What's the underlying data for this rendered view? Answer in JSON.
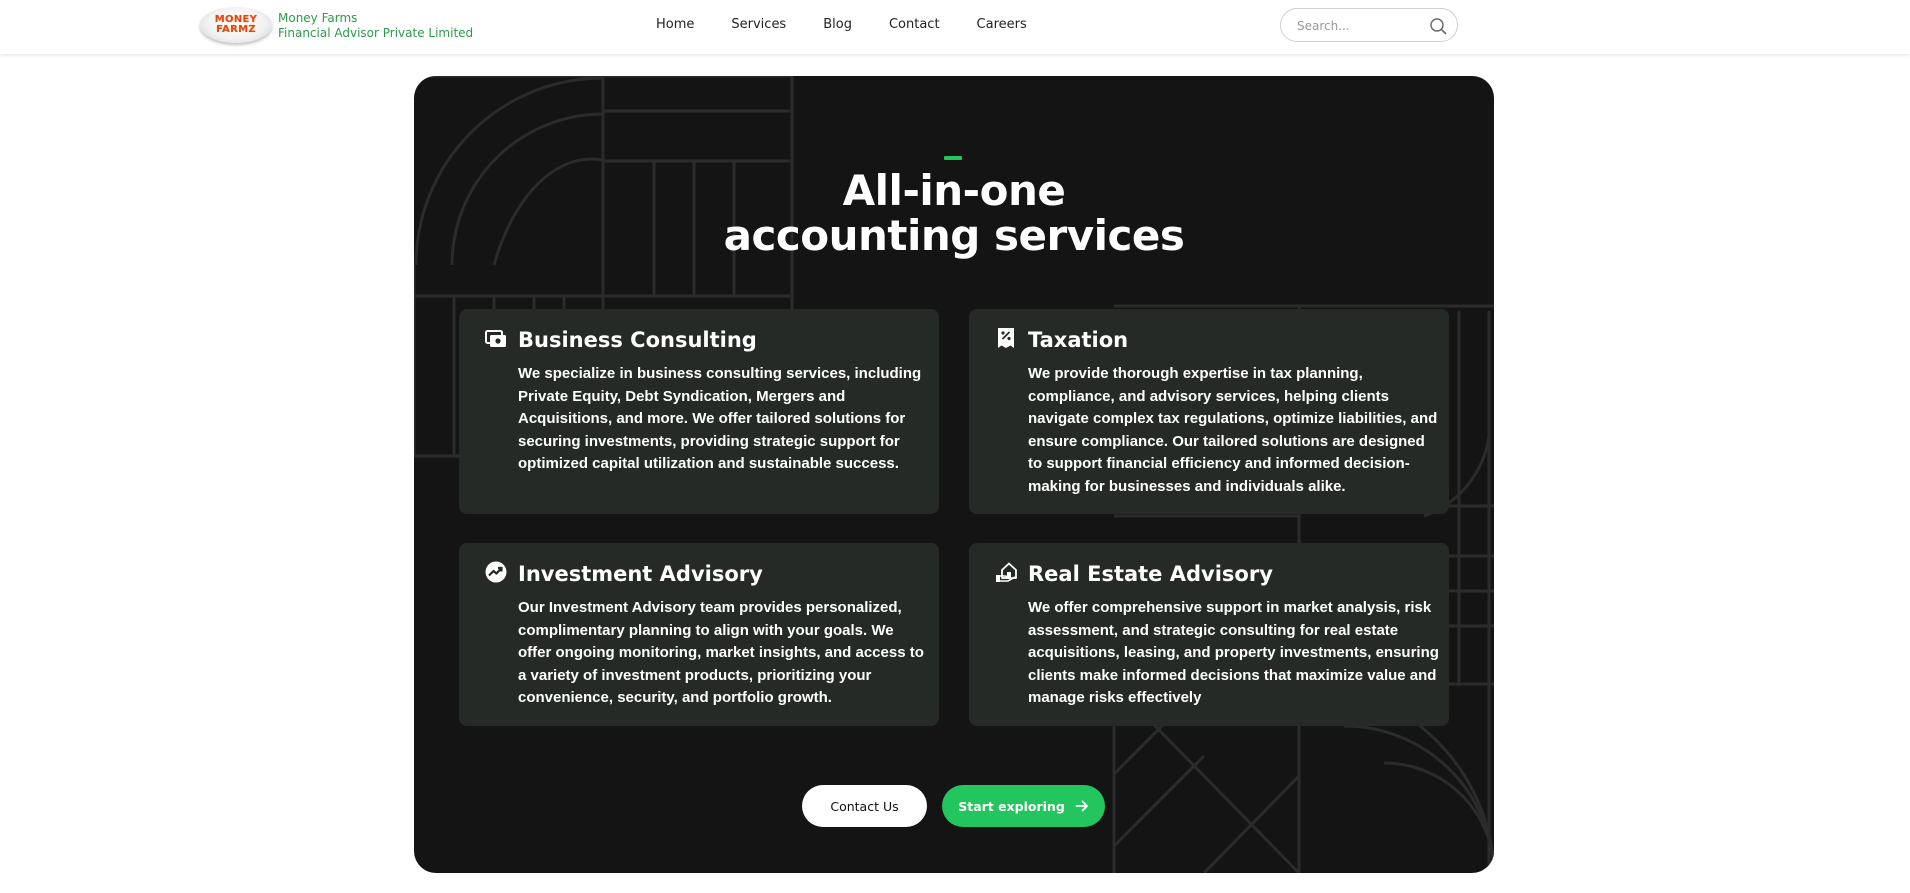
{
  "header": {
    "logo": {
      "line1": "MONEY",
      "line2": "FARMZ"
    },
    "brand": {
      "name": "Money Farms",
      "tagline": "Financial Advisor Private Limited"
    },
    "nav": [
      {
        "label": "Home"
      },
      {
        "label": "Services"
      },
      {
        "label": "Blog"
      },
      {
        "label": "Contact"
      },
      {
        "label": "Careers"
      }
    ],
    "search": {
      "placeholder": "Search...",
      "value": ""
    }
  },
  "services_section": {
    "title_line1": "All-in-one",
    "title_line2": "accounting services",
    "cards": [
      {
        "icon": "briefcase-icon",
        "title": "Business Consulting",
        "description": "We specialize in business consulting services, including Private Equity, Debt Syndication, Mergers and Acquisitions, and more. We offer tailored solutions for securing investments, providing strategic support for optimized capital utilization and sustainable success."
      },
      {
        "icon": "tax-receipt-icon",
        "title": "Taxation",
        "description": "We provide thorough expertise in tax planning, compliance, and advisory services, helping clients navigate complex tax regulations, optimize liabilities, and ensure compliance. Our tailored solutions are designed to support financial efficiency and informed decision-making for businesses and individuals alike."
      },
      {
        "icon": "trending-up-icon",
        "title": "Investment Advisory",
        "description": "Our Investment Advisory team provides personalized, complimentary planning to align with your goals. We offer ongoing monitoring, market insights, and access to a variety of investment products, prioritizing your convenience, security, and portfolio growth."
      },
      {
        "icon": "home-hand-icon",
        "title": "Real Estate Advisory",
        "description": "We offer comprehensive support in market analysis, risk assessment, and strategic consulting for real estate acquisitions, leasing, and property investments, ensuring clients make informed decisions that maximize value and manage risks effectively"
      }
    ],
    "buttons": {
      "contact": "Contact Us",
      "explore": "Start exploring"
    }
  },
  "colors": {
    "brand_green": "#2e9a4a",
    "accent_green": "#22c55e",
    "section_bg": "#141414",
    "card_bg": "#262a27",
    "logo_orange": "#e0461a"
  }
}
